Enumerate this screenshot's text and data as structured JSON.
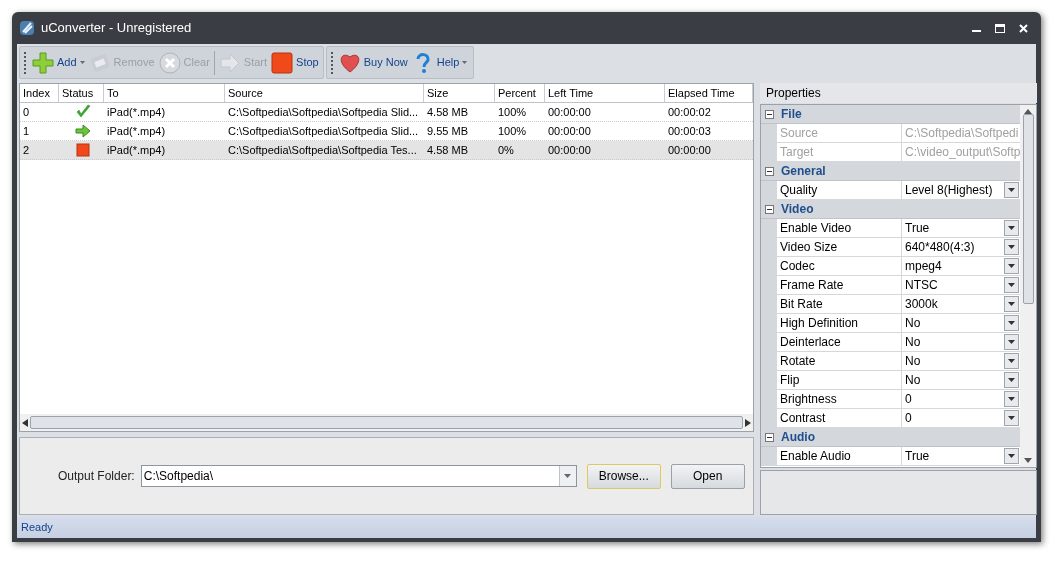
{
  "window": {
    "title": "uConverter - Unregistered"
  },
  "toolbar": [
    {
      "kind": "add",
      "label": "Add",
      "disabled": false,
      "dropdown": true
    },
    {
      "kind": "remove",
      "label": "Remove",
      "disabled": true,
      "dropdown": false
    },
    {
      "kind": "clear",
      "label": "Clear",
      "disabled": true,
      "dropdown": false
    },
    {
      "kind": "start",
      "label": "Start",
      "disabled": true,
      "dropdown": false
    },
    {
      "kind": "stop",
      "label": "Stop",
      "disabled": false,
      "dropdown": false
    },
    {
      "kind": "buy",
      "label": "Buy Now",
      "disabled": false,
      "dropdown": false
    },
    {
      "kind": "help",
      "label": "Help",
      "disabled": false,
      "dropdown": true
    }
  ],
  "table": {
    "columns": [
      "Index",
      "Status",
      "To",
      "Source",
      "Size",
      "Percent",
      "Left Time",
      "Elapsed Time"
    ],
    "rows": [
      {
        "index": "0",
        "kind": "done",
        "to": "iPad(*.mp4)",
        "source": "C:\\Softpedia\\Softpedia\\Softpedia Slid...",
        "size": "4.58 MB",
        "percent": "100%",
        "left_time": "00:00:00",
        "elapsed_time": "00:00:02",
        "selected": false
      },
      {
        "index": "1",
        "kind": "converting",
        "to": "iPad(*.mp4)",
        "source": "C:\\Softpedia\\Softpedia\\Softpedia Slid...",
        "size": "9.55 MB",
        "percent": "100%",
        "left_time": "00:00:00",
        "elapsed_time": "00:00:03",
        "selected": false
      },
      {
        "index": "2",
        "kind": "stopped",
        "to": "iPad(*.mp4)",
        "source": "C:\\Softpedia\\Softpedia\\Softpedia Tes...",
        "size": "4.58 MB",
        "percent": "0%",
        "left_time": "00:00:00",
        "elapsed_time": "00:00:00",
        "selected": true
      }
    ]
  },
  "output": {
    "label": "Output Folder:",
    "value": "C:\\Softpedia\\",
    "buttons": [
      {
        "label": "Browse...",
        "focused": true
      },
      {
        "label": "Open",
        "focused": false
      }
    ]
  },
  "properties": {
    "title": "Properties",
    "groups": [
      {
        "name": "File",
        "expanded": true,
        "items": [
          {
            "name": "Source",
            "value": "C:\\Softpedia\\Softpedi",
            "disabled": true,
            "dropdown": false
          },
          {
            "name": "Target",
            "value": "C:\\video_output\\Softp",
            "disabled": true,
            "dropdown": false
          }
        ]
      },
      {
        "name": "General",
        "expanded": true,
        "items": [
          {
            "name": "Quality",
            "value": "Level 8(Highest)",
            "disabled": false,
            "dropdown": true
          }
        ]
      },
      {
        "name": "Video",
        "expanded": true,
        "items": [
          {
            "name": "Enable Video",
            "value": "True",
            "disabled": false,
            "dropdown": true
          },
          {
            "name": "Video Size",
            "value": "640*480(4:3)",
            "disabled": false,
            "dropdown": true
          },
          {
            "name": "Codec",
            "value": "mpeg4",
            "disabled": false,
            "dropdown": true
          },
          {
            "name": "Frame Rate",
            "value": "NTSC",
            "disabled": false,
            "dropdown": true
          },
          {
            "name": "Bit Rate",
            "value": "3000k",
            "disabled": false,
            "dropdown": true
          },
          {
            "name": "High Definition",
            "value": "No",
            "disabled": false,
            "dropdown": true
          },
          {
            "name": "Deinterlace",
            "value": "No",
            "disabled": false,
            "dropdown": true
          },
          {
            "name": "Rotate",
            "value": "No",
            "disabled": false,
            "dropdown": true
          },
          {
            "name": "Flip",
            "value": "No",
            "disabled": false,
            "dropdown": true
          },
          {
            "name": "Brightness",
            "value": "0",
            "disabled": false,
            "dropdown": true
          },
          {
            "name": "Contrast",
            "value": "0",
            "disabled": false,
            "dropdown": true
          }
        ]
      },
      {
        "name": "Audio",
        "expanded": true,
        "items": [
          {
            "name": "Enable Audio",
            "value": "True",
            "disabled": false,
            "dropdown": true
          }
        ]
      }
    ]
  },
  "status_bar": {
    "text": "Ready"
  }
}
